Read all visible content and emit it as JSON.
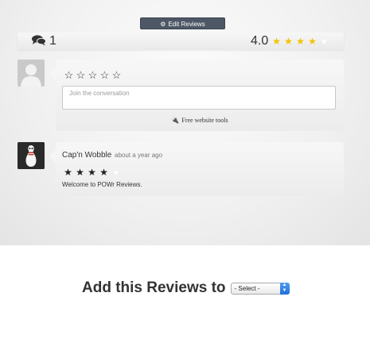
{
  "toolbar": {
    "edit_label": "Edit Reviews",
    "edit_icon": "gears-icon"
  },
  "summary": {
    "comment_count": "1",
    "average_rating": "4.0",
    "rating_value": 4,
    "max_rating": 5,
    "star_color": "#f2c300"
  },
  "compose": {
    "placeholder": "Join the conversation",
    "powered_by": "Free website tools",
    "stars_selected": 0,
    "stars_total": 5
  },
  "review": {
    "author": "Cap'n Wobble",
    "time_ago": "about a year ago",
    "rating": 4,
    "max_rating": 5,
    "text": "Welcome to POWr Reviews."
  },
  "add_to": {
    "title": "Add this Reviews to",
    "select_value": "- Select -"
  },
  "colors": {
    "button_bg": "#4d5766",
    "select_accent": "#2f82e8"
  }
}
